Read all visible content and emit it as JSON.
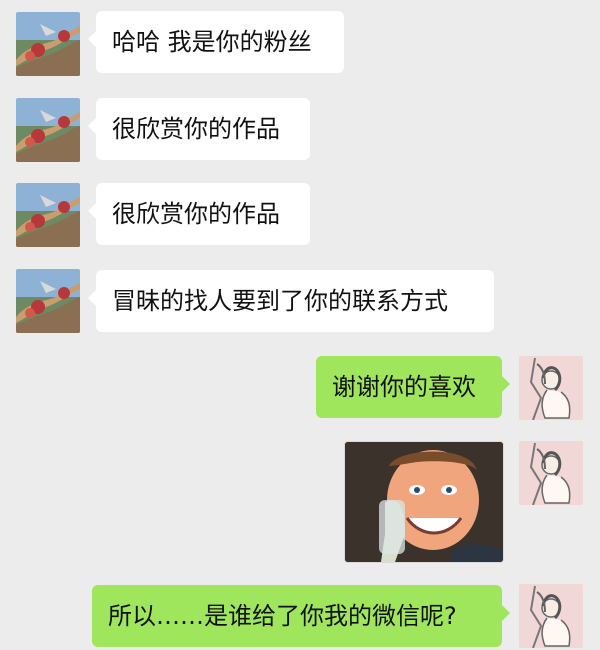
{
  "messages": {
    "m1": "哈哈 我是你的粉丝",
    "m2": "很欣赏你的作品",
    "m3": "很欣赏你的作品",
    "m4": "冒昧的找人要到了你的联系方式",
    "m5": "谢谢你的喜欢",
    "m6": "所以……是谁给了你我的微信呢?"
  },
  "colors": {
    "background": "#ececec",
    "left_bubble": "#ffffff",
    "right_bubble": "#9fe65c"
  },
  "icons": {
    "sender_avatar": "great-wall-avatar",
    "receiver_avatar": "woman-drawing-avatar",
    "image_message": "smiling-man-photo"
  }
}
